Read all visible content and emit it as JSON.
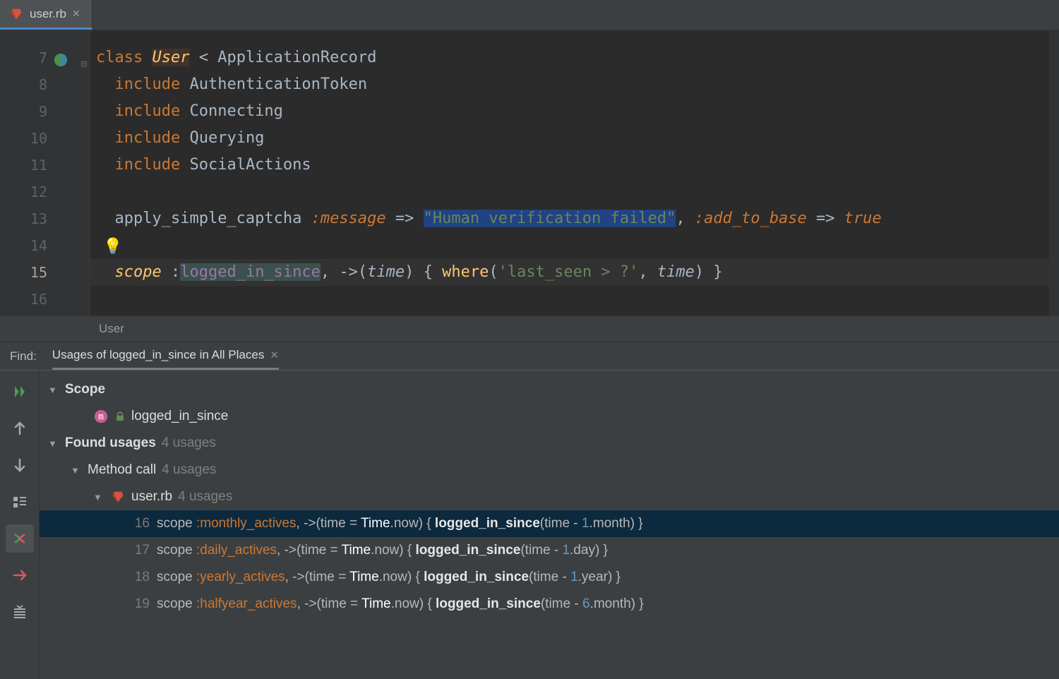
{
  "tabs": [
    {
      "label": "user.rb",
      "icon": "ruby-file-icon",
      "active": true
    }
  ],
  "gutter": {
    "start": 7,
    "end": 16,
    "class_line": 7,
    "bulb_line": 14,
    "current_line": 15
  },
  "code": {
    "lines": [
      {
        "ln": 7,
        "html": "<span class='tok-kw'>class </span><span class='tok-def-hl'>User</span><span class='tok-plain'> &lt; ApplicationRecord</span>"
      },
      {
        "ln": 8,
        "html": "  <span class='tok-kw'>include </span><span class='tok-plain'>AuthenticationToken</span>"
      },
      {
        "ln": 9,
        "html": "  <span class='tok-kw'>include </span><span class='tok-plain'>Connecting</span>"
      },
      {
        "ln": 10,
        "html": "  <span class='tok-kw'>include </span><span class='tok-plain'>Querying</span>"
      },
      {
        "ln": 11,
        "html": "  <span class='tok-kw'>include </span><span class='tok-plain'>SocialActions</span>"
      },
      {
        "ln": 12,
        "html": ""
      },
      {
        "ln": 13,
        "html": "  <span class='tok-plain'>apply_simple_captcha </span><span class='tok-symkey'>:message</span><span class='tok-plain'> =&gt; </span><span class='tok-str-hl'>\"Human verification failed\"</span><span class='tok-plain'>, </span><span class='tok-symkey'>:add_to_base</span><span class='tok-plain'> =&gt; </span><span class='tok-true'>true</span>"
      },
      {
        "ln": 14,
        "html": ""
      },
      {
        "ln": 15,
        "html": "  <span class='tok-scope'>scope </span><span class='tok-plain'>:</span><span class='tok-caret-sym'>logged_in_since</span><span class='tok-plain'>, -&gt;(</span><span class='tok-param'>time</span><span class='tok-plain'>) { </span><span class='tok-call'>where</span><span class='tok-plain'>(</span><span class='tok-str'>'last_seen &gt; ?'</span><span class='tok-plain'>, </span><span class='tok-param'>time</span><span class='tok-plain'>) }</span>"
      },
      {
        "ln": 16,
        "html": ""
      }
    ]
  },
  "breadcrumb": "User",
  "find": {
    "label": "Find:",
    "tab_title": "Usages of logged_in_since in All Places",
    "scope_label": "Scope",
    "scope_method": "logged_in_since",
    "found_label": "Found usages",
    "found_count": "4 usages",
    "group_label": "Method call",
    "group_count": "4 usages",
    "file_label": "user.rb",
    "file_count": "4 usages",
    "usages": [
      {
        "ln": "16",
        "prefix": "scope ",
        "sym": ":monthly_actives",
        "mid": ", ->(time = ",
        "time": "Time",
        "rest1": ".now) { ",
        "hit": "logged_in_since",
        "rest2": "(time - ",
        "num": "1",
        "unit": ".month) }",
        "selected": true
      },
      {
        "ln": "17",
        "prefix": "scope ",
        "sym": ":daily_actives",
        "mid": ", ->(time = ",
        "time": "Time",
        "rest1": ".now) { ",
        "hit": "logged_in_since",
        "rest2": "(time - ",
        "num": "1",
        "unit": ".day) }",
        "selected": false
      },
      {
        "ln": "18",
        "prefix": "scope ",
        "sym": ":yearly_actives",
        "mid": ", ->(time = ",
        "time": "Time",
        "rest1": ".now) { ",
        "hit": "logged_in_since",
        "rest2": "(time - ",
        "num": "1",
        "unit": ".year) }",
        "selected": false
      },
      {
        "ln": "19",
        "prefix": "scope ",
        "sym": ":halfyear_actives",
        "mid": ", ->(time = ",
        "time": "Time",
        "rest1": ".now) { ",
        "hit": "logged_in_since",
        "rest2": "(time - ",
        "num": "6",
        "unit": ".month) }",
        "selected": false
      }
    ]
  }
}
